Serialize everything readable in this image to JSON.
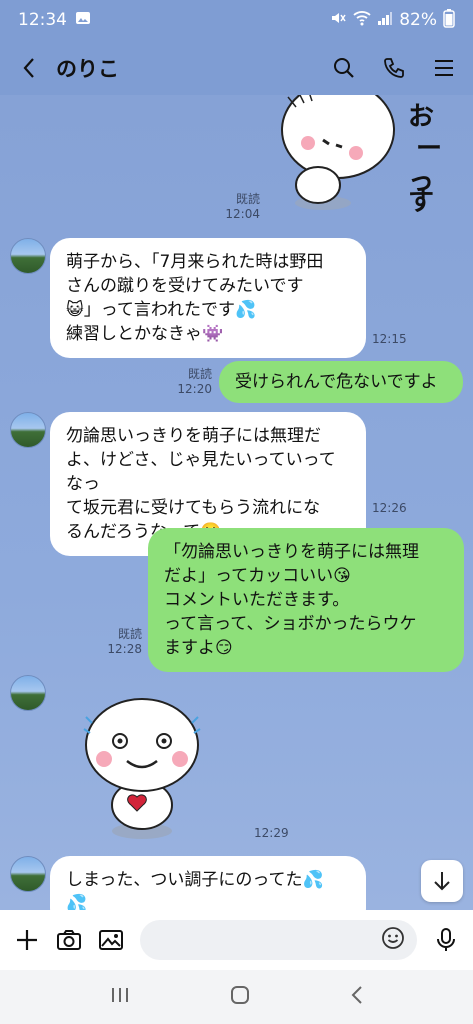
{
  "status": {
    "time": "12:34",
    "battery": "82%"
  },
  "header": {
    "title": "のりこ"
  },
  "messages": [
    {
      "side": "out",
      "type": "sticker",
      "read": "既読",
      "time": "12:04",
      "sticker_text": "おつかれさまーっす"
    },
    {
      "side": "in",
      "type": "text",
      "time": "12:15",
      "lines": [
        "萌子から、「7月来られた時は野田",
        "さんの蹴りを受けてみたいです",
        "😺」って言われたです💦",
        "練習しとかなきゃ👾"
      ]
    },
    {
      "side": "out",
      "type": "text",
      "read": "既読",
      "time": "12:20",
      "text": "受けられんで危ないですよ"
    },
    {
      "side": "in",
      "type": "text",
      "time": "12:26",
      "lines": [
        "勿論思いっきりを萌子には無理だ",
        "よ、けどさ、じゃ見たいっていってなっ",
        "て坂元君に受けてもらう流れにな",
        "るんだろうなって🙄"
      ]
    },
    {
      "side": "out",
      "type": "text",
      "read": "既読",
      "time": "12:28",
      "lines": [
        "「勿論思いっきりを萌子には無理",
        "だよ」ってカッコいい😘",
        "コメントいただきます。",
        "って言って、ショボかったらウケ",
        "ますよ😏"
      ]
    },
    {
      "side": "in",
      "type": "sticker",
      "time": "12:29"
    },
    {
      "side": "in",
      "type": "text",
      "lines": [
        "しまった、つい調子にのってた💦",
        "💦"
      ]
    }
  ],
  "composer": {
    "placeholder": ""
  },
  "icons": {
    "back": "chevron-left-icon",
    "search": "search-icon",
    "call": "phone-icon",
    "menu": "menu-icon",
    "plus": "plus-icon",
    "camera": "camera-icon",
    "image": "image-icon",
    "emoji": "emoji-icon",
    "mic": "mic-icon",
    "scroll": "arrow-down-icon"
  },
  "colors": {
    "background": "#8aa6d8",
    "bubble_out": "#8ee07a",
    "bubble_in": "#ffffff"
  }
}
